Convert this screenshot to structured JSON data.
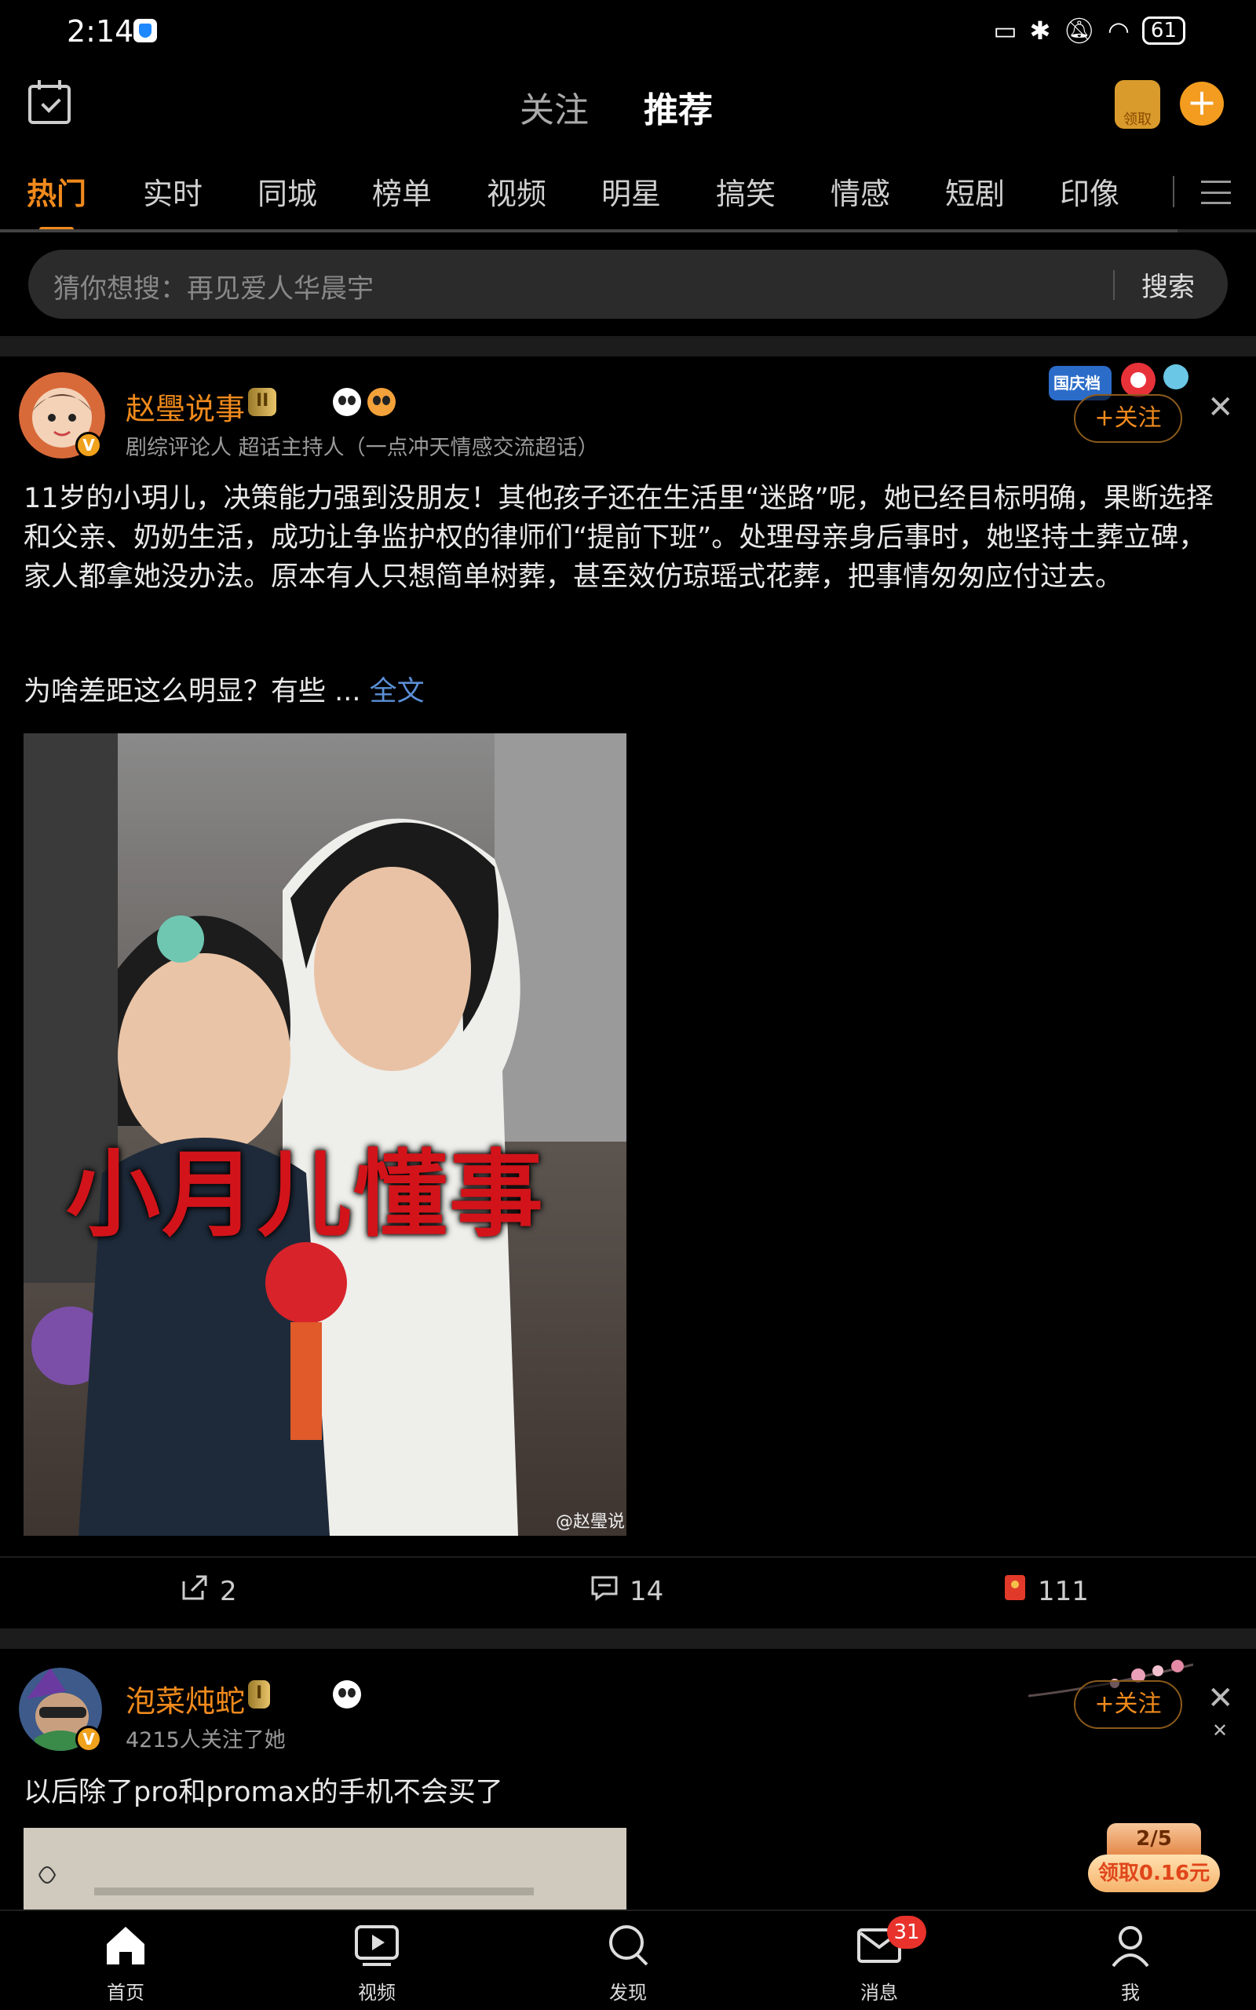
{
  "status_bar": {
    "time": "2:14",
    "battery": "61"
  },
  "top_nav": {
    "tabs": [
      "关注",
      "推荐"
    ],
    "active": "推荐",
    "coin_label": "领取"
  },
  "categories": [
    "热门",
    "实时",
    "同城",
    "榜单",
    "视频",
    "明星",
    "搞笑",
    "情感",
    "短剧",
    "印像"
  ],
  "search": {
    "placeholder": "猜你想搜：再见爱人华晨宇",
    "button": "搜索"
  },
  "posts": [
    {
      "username": "赵璺说事",
      "level": "II",
      "subtitle": "剧综评论人 超话主持人（一点冲天情感交流超话）",
      "follow_label": "+关注",
      "deco_label": "国庆档",
      "text": "11岁的小玥儿，决策能力强到没朋友！其他孩子还在生活里“迷路”呢，她已经目标明确，果断选择和父亲、奶奶生活，成功让争监护权的律师们“提前下班”。处理母亲身后事时，她坚持土葬立碑，家人都拿她没办法。原本有人只想简单树葬，甚至效仿琼瑶式花葬，把事情匆匆应付过去。",
      "text2": "为啥差距这么明显？有些 ...",
      "more": "全文",
      "image_caption": "小月儿懂事",
      "watermark": "@赵璺说",
      "shares": "2",
      "comments": "14",
      "likes": "111"
    },
    {
      "username": "泡菜炖蛇",
      "level": "I",
      "subtitle": "4215人关注了她",
      "follow_label": "+关注",
      "text": "以后除了pro和promax的手机不会买了"
    }
  ],
  "task_badge": {
    "progress": "2/5",
    "reward": "领取0.16元"
  },
  "bottom_nav": {
    "items": [
      "首页",
      "视频",
      "发现",
      "消息",
      "我"
    ],
    "message_count": "31"
  },
  "colors": {
    "accent": "#f08a1c",
    "link": "#5b8fd6",
    "badge": "#e8322b"
  }
}
